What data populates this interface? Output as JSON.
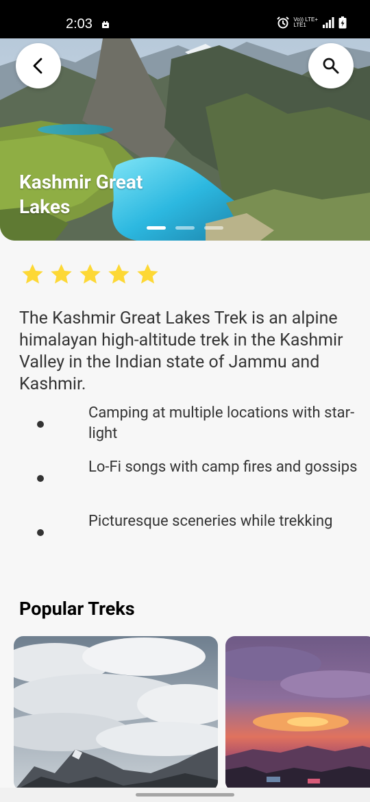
{
  "status_bar": {
    "time": "2:03",
    "network_top": "Vo)) LTE+",
    "network_bottom": "LTE1"
  },
  "hero": {
    "title": "Kashmir Great Lakes",
    "slide_count": 3,
    "active_slide": 0
  },
  "rating": {
    "stars": 5,
    "color": "#FDD835"
  },
  "description": "The Kashmir Great Lakes Trek is an alpine himalayan high-altitude trek in the Kashmir Valley in the Indian state of Jammu and Kashmir.",
  "highlights": [
    "Camping at multiple locations with star-light",
    "Lo-Fi songs with camp fires and gossips",
    "Picturesque sceneries while trekking"
  ],
  "popular": {
    "title": "Popular Treks"
  },
  "icons": {
    "back": "chevron-left-icon",
    "search": "search-icon"
  }
}
